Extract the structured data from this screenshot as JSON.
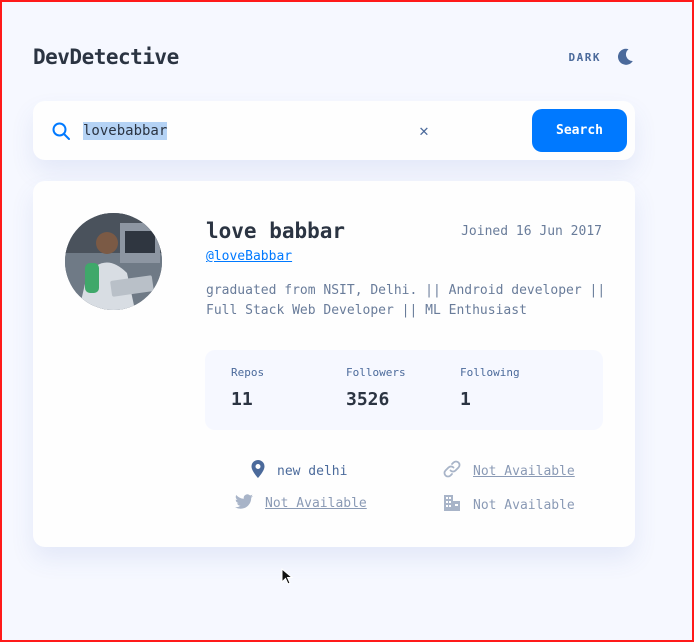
{
  "app": {
    "title": "DevDetective",
    "mode_label": "DARK"
  },
  "search": {
    "query": "lovebabbar",
    "clear_symbol": "✕",
    "button_label": "Search"
  },
  "profile": {
    "name": "love babbar",
    "joined": "Joined 16 Jun 2017",
    "handle": "@loveBabbar",
    "bio": "graduated from NSIT, Delhi. || Android developer || Full Stack Web Developer || ML Enthusiast"
  },
  "stats": [
    {
      "label": "Repos",
      "value": "11"
    },
    {
      "label": "Followers",
      "value": "3526"
    },
    {
      "label": "Following",
      "value": "1"
    }
  ],
  "links": {
    "location": "new delhi",
    "website": "Not Available",
    "twitter": "Not Available",
    "company": "Not Available"
  },
  "colors": {
    "accent": "#0079ff",
    "background": "#f6f8ff",
    "card": "#fefefe",
    "muted": "#4b6a9b"
  }
}
